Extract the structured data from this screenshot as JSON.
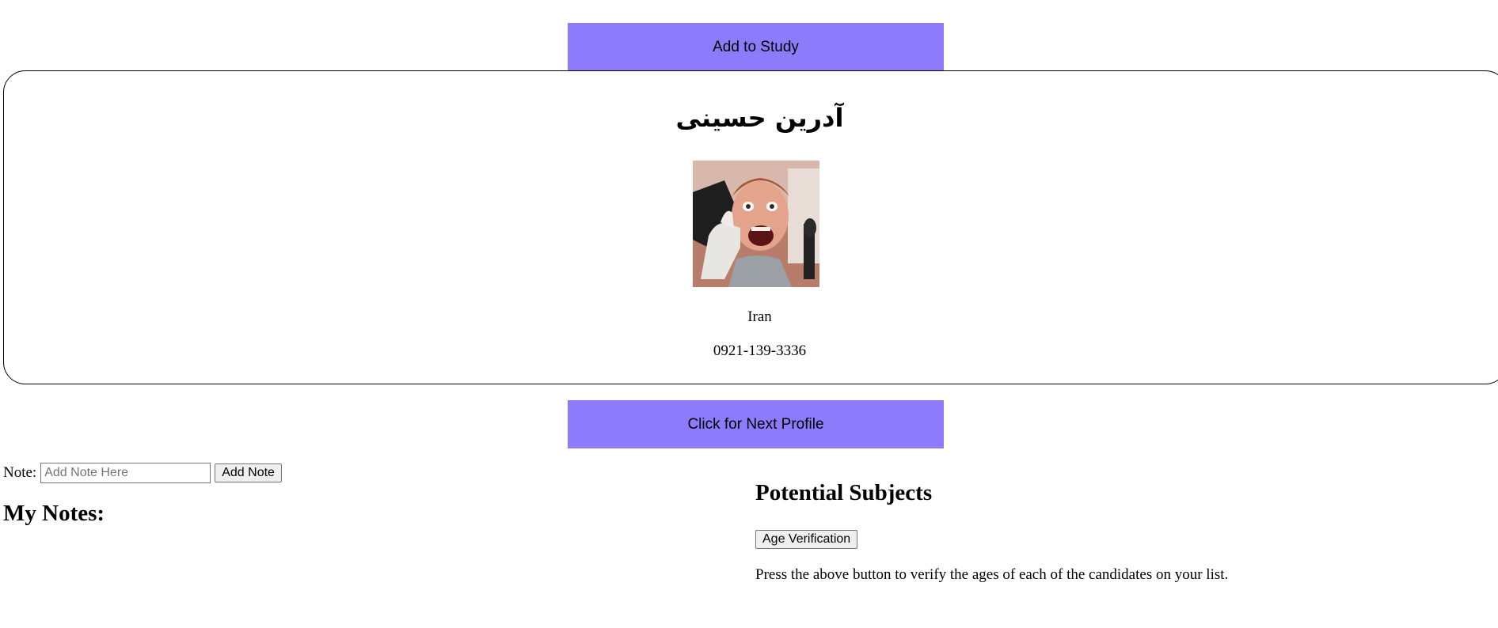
{
  "actions": {
    "add_to_study_label": "Add to Study",
    "next_profile_label": "Click for Next Profile"
  },
  "profile": {
    "name": "آدرین حسینی",
    "country": "Iran",
    "phone": "0921-139-3336"
  },
  "notes": {
    "label": "Note:",
    "placeholder": "Add Note Here",
    "add_button_label": "Add Note",
    "heading": "My Notes:"
  },
  "subjects": {
    "heading": "Potential Subjects",
    "age_verification_label": "Age Verification",
    "description": "Press the above button to verify the ages of each of the candidates on your list."
  },
  "colors": {
    "accent_button": "#8c7cfb"
  }
}
